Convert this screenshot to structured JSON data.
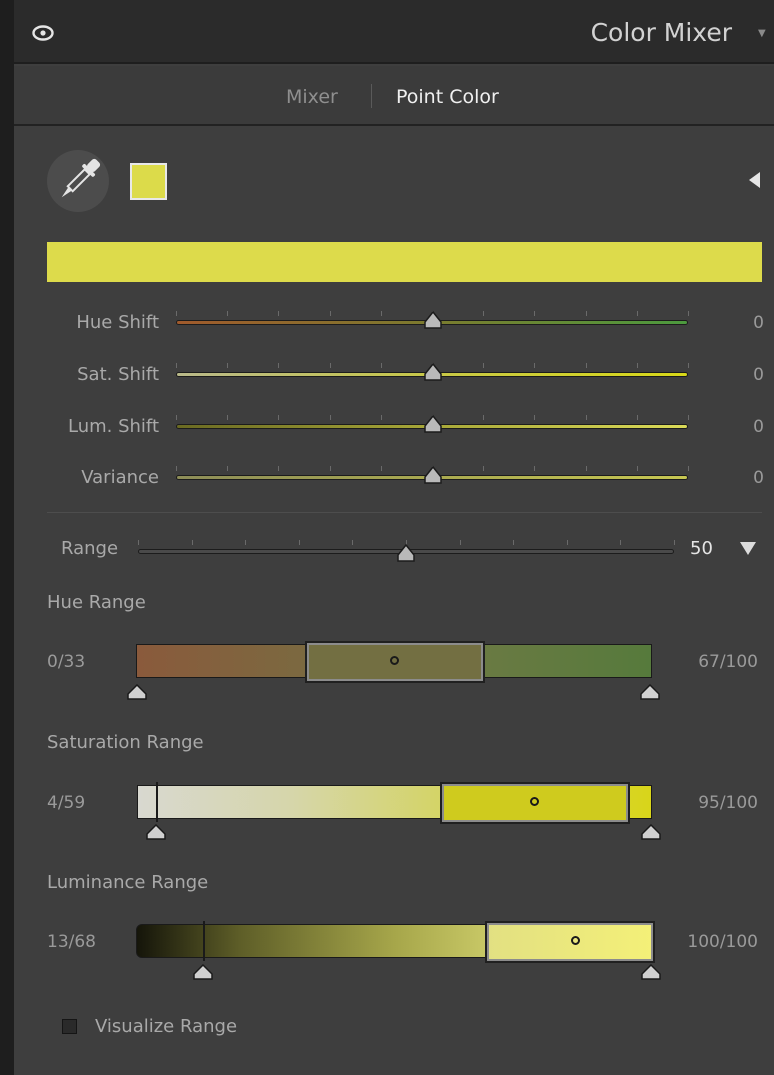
{
  "header": {
    "title": "Color Mixer",
    "visibility_icon": "eye-icon",
    "collapse_icon": "panel-collapse-triangle-icon"
  },
  "tabs": [
    {
      "label": "Mixer",
      "active": false
    },
    {
      "label": "Point Color",
      "active": true
    }
  ],
  "picker": {
    "icon": "eyedropper-icon",
    "swatch_color": "#dcdb4a",
    "expand_icon": "triangle-left-icon"
  },
  "selected_color": "#dddb4b",
  "adjustments": [
    {
      "label": "Hue Shift",
      "value": "0",
      "position": 0.5
    },
    {
      "label": "Sat. Shift",
      "value": "0",
      "position": 0.5
    },
    {
      "label": "Lum. Shift",
      "value": "0",
      "position": 0.5
    },
    {
      "label": "Variance",
      "value": "0",
      "position": 0.5
    }
  ],
  "range": {
    "label": "Range",
    "value": "50",
    "position": 0.5,
    "dropdown_icon": "triangle-down-icon"
  },
  "ranges": [
    {
      "title": "Hue Range",
      "min": "0/33",
      "max": "67/100"
    },
    {
      "title": "Saturation Range",
      "min": "4/59",
      "max": "95/100"
    },
    {
      "title": "Luminance Range",
      "min": "13/68",
      "max": "100/100"
    }
  ],
  "visualize": {
    "label": "Visualize Range",
    "checked": false
  }
}
